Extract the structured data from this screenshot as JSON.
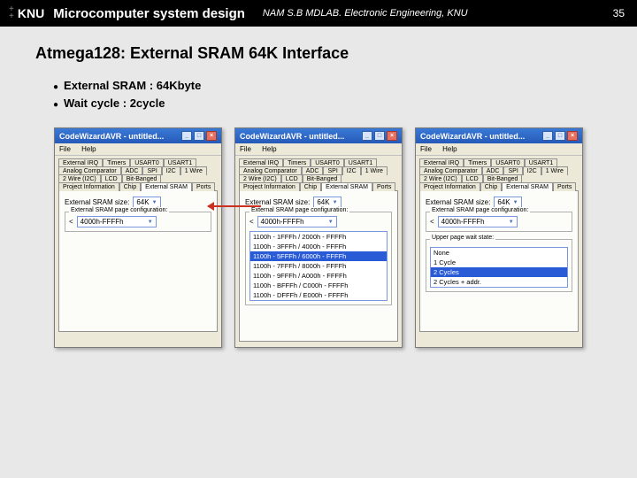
{
  "header": {
    "logo": "KNU",
    "title": "Microcomputer system design",
    "subtitle": "NAM S.B MDLAB. Electronic Engineering, KNU",
    "page": "35"
  },
  "heading": "Atmega128: External SRAM 64K Interface",
  "bullets": [
    "External SRAM : 64Kbyte",
    "Wait cycle : 2cycle"
  ],
  "wizard": {
    "title": "CodeWizardAVR - untitled...",
    "menu": {
      "file": "File",
      "help": "Help"
    },
    "tabs_row1": [
      "External IRQ",
      "Timers",
      "USART0",
      "USART1"
    ],
    "tabs_row2": [
      "Analog Comparator",
      "ADC",
      "SPI",
      "I2C"
    ],
    "tabs_row3": [
      "1 Wire",
      "2 Wire (I2C)",
      "LCD"
    ],
    "tabs_row4": [
      "Bit-Banged",
      "Project Information"
    ],
    "tabs_row5": [
      "Chip",
      "External SRAM",
      "Ports"
    ],
    "active_tab": "External SRAM",
    "size_label": "External SRAM size:",
    "size_value": "64K",
    "group_label": "External SRAM page configuration:",
    "addr_prefix": "<",
    "addr_value": "4000h-FFFFh"
  },
  "panel2": {
    "list": [
      "1100h - 1FFFh / 2000h - FFFFh",
      "1100h - 3FFFh / 4000h - FFFFh",
      "1100h - 5FFFh / 6000h - FFFFh",
      "1100h - 7FFFh / 8000h - FFFFh",
      "1100h - 9FFFh / A000h - FFFFh",
      "1100h - BFFFh / C000h - FFFFh",
      "1100h - DFFFh / E000h - FFFFh"
    ],
    "selected_index": 2
  },
  "panel3": {
    "wait_group": "Upper page wait state:",
    "wait_list": [
      "None",
      "1 Cycle",
      "2 Cycles",
      "2 Cycles + addr."
    ],
    "wait_selected": 2
  }
}
